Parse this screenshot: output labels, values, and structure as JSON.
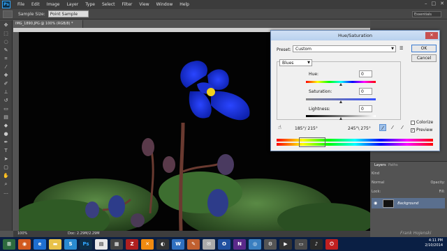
{
  "menubar": {
    "logo": "Ps",
    "items": [
      "File",
      "Edit",
      "Image",
      "Layer",
      "Type",
      "Select",
      "Filter",
      "View",
      "Window",
      "Help"
    ],
    "window_controls": [
      "–",
      "□",
      "✕"
    ]
  },
  "options": {
    "sample_size_label": "Sample Size:",
    "sample_size_value": "Point Sample",
    "workspace": "Essentials"
  },
  "document": {
    "tab_title": "IMG_1890.JPG @ 100% (RGB/8) *",
    "zoom": "100%",
    "doc_size": "Doc: 2.29M/2.29M"
  },
  "dialog": {
    "title": "Hue/Saturation",
    "preset_label": "Preset:",
    "preset_value": "Custom",
    "ok": "OK",
    "cancel": "Cancel",
    "channel": "Blues",
    "hue_label": "Hue:",
    "hue_value": "0",
    "saturation_label": "Saturation:",
    "saturation_value": "0",
    "lightness_label": "Lightness:",
    "lightness_value": "0",
    "colorize_label": "Colorize",
    "preview_label": "Preview",
    "range_left": "185°/ 215°",
    "range_right": "245°\\ 275°"
  },
  "layers": {
    "tab_layers": "Layers",
    "tab_paths": "Paths",
    "kind": "Kind",
    "blend": "Normal",
    "opacity": "Opacity:",
    "lock": "Lock:",
    "fill": "Fill:",
    "layer_name": "Background"
  },
  "watermark": "Frank Hojenski",
  "taskbar": {
    "time": "4:11 PM",
    "date": "2/10/2014"
  }
}
